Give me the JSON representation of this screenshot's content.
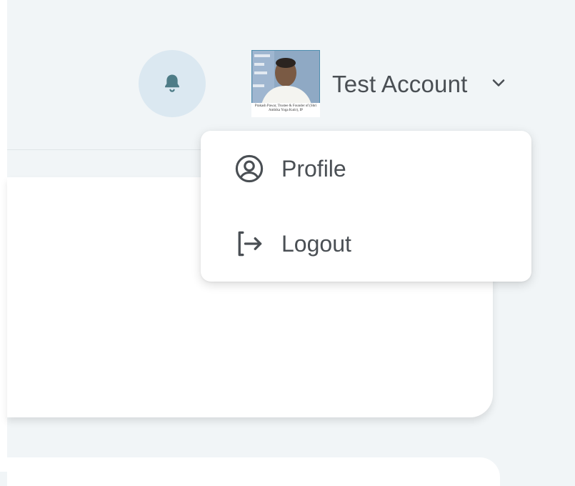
{
  "header": {
    "notification_icon": "bell-icon",
    "account": {
      "name": "Test Account",
      "avatar_caption": "Prakash Pawar, Trustee & Founder of (Shri Ambika Yoga Kutir), IP",
      "chevron_icon": "chevron-down-icon"
    }
  },
  "account_menu": {
    "items": [
      {
        "label": "Profile",
        "icon": "user-circle-icon"
      },
      {
        "label": "Logout",
        "icon": "logout-icon"
      }
    ]
  },
  "colors": {
    "page_background": "#f1f5f7",
    "bell_button_bg": "#dbe8f1",
    "bell_icon": "#4e7c87",
    "text": "#4a4f54",
    "card": "#ffffff"
  }
}
